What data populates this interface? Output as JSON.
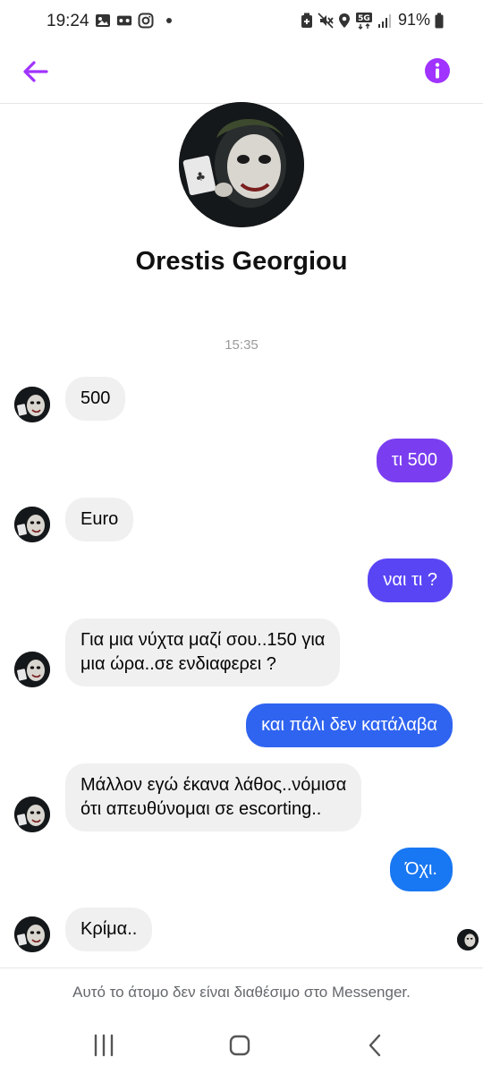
{
  "status_bar": {
    "time": "19:24",
    "battery": "91%",
    "network": "5G",
    "left_icons": [
      "image-icon",
      "voicemail-icon",
      "instagram-icon",
      "notification-dot"
    ],
    "right_icons": [
      "battery-saver-icon",
      "mute-icon",
      "location-icon",
      "5g-icon",
      "signal-icon",
      "battery-icon"
    ]
  },
  "header": {
    "back_icon": "arrow-left-icon",
    "info_icon": "info-icon"
  },
  "profile": {
    "name": "Orestis Georgiou"
  },
  "conversation": {
    "timestamp": "15:35",
    "messages": [
      {
        "direction": "incoming",
        "text": "500"
      },
      {
        "direction": "outgoing",
        "text": "τι 500"
      },
      {
        "direction": "incoming",
        "text": "Euro"
      },
      {
        "direction": "outgoing",
        "text": "ναι τι ?"
      },
      {
        "direction": "incoming",
        "line1": "Για μια νύχτα μαζί σου..150 για",
        "line2": "μια ώρα..σε ενδιαφερει ?"
      },
      {
        "direction": "outgoing",
        "text": "και πάλι δεν κατάλαβα"
      },
      {
        "direction": "incoming",
        "line1": "Μάλλον εγώ έκανα λάθος..νόμισα",
        "line2": "ότι απευθύνομαι σε escorting.."
      },
      {
        "direction": "outgoing",
        "text": "Όχι."
      },
      {
        "direction": "incoming",
        "text": "Κρίμα.."
      }
    ]
  },
  "footer": {
    "notice": "Αυτό το άτομο δεν είναι διαθέσιμο στο Messenger."
  },
  "colors": {
    "accent": "#a033ff",
    "outgoing_1": "#7a3ef0",
    "outgoing_2": "#5a45f5",
    "outgoing_3": "#2f64f0",
    "outgoing_4": "#1877f2",
    "incoming_bg": "#f0f0f0"
  },
  "nav_bar": {
    "icons": [
      "recents-icon",
      "home-icon",
      "back-icon"
    ]
  }
}
